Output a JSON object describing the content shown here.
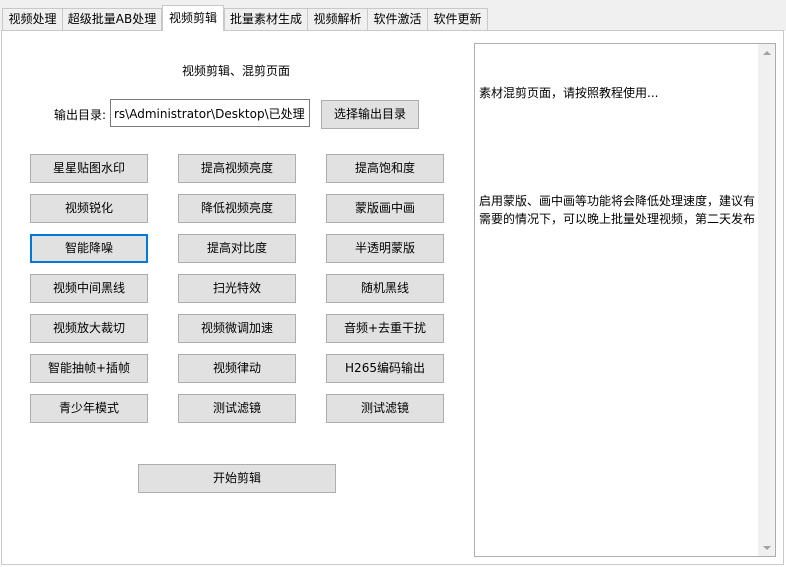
{
  "tabs": [
    {
      "label": "视频处理",
      "active": false
    },
    {
      "label": "超级批量AB处理",
      "active": false
    },
    {
      "label": "视频剪辑",
      "active": true
    },
    {
      "label": "批量素材生成",
      "active": false
    },
    {
      "label": "视频解析",
      "active": false
    },
    {
      "label": "软件激活",
      "active": false
    },
    {
      "label": "软件更新",
      "active": false
    }
  ],
  "page_title": "视频剪辑、混剪页面",
  "output": {
    "label": "输出目录:",
    "value": "rs\\Administrator\\Desktop\\已处理",
    "select_button": "选择输出目录"
  },
  "effects": [
    [
      "星星贴图水印",
      "提高视频亮度",
      "提高饱和度"
    ],
    [
      "视频锐化",
      "降低视频亮度",
      "蒙版画中画"
    ],
    [
      "智能降噪",
      "提高对比度",
      "半透明蒙版"
    ],
    [
      "视频中间黑线",
      "扫光特效",
      "随机黑线"
    ],
    [
      "视频放大裁切",
      "视频微调加速",
      "音频+去重干扰"
    ],
    [
      "智能抽帧+插帧",
      "视频律动",
      "H265编码输出"
    ],
    [
      "青少年模式",
      "测试滤镜",
      "测试滤镜"
    ]
  ],
  "start_button": "开始剪辑",
  "log": {
    "line1": "素材混剪页面，请按照教程使用...",
    "line2": "启用蒙版、画中画等功能将会降低处理速度，建议有需要的情况下，可以晚上批量处理视频，第二天发布"
  }
}
